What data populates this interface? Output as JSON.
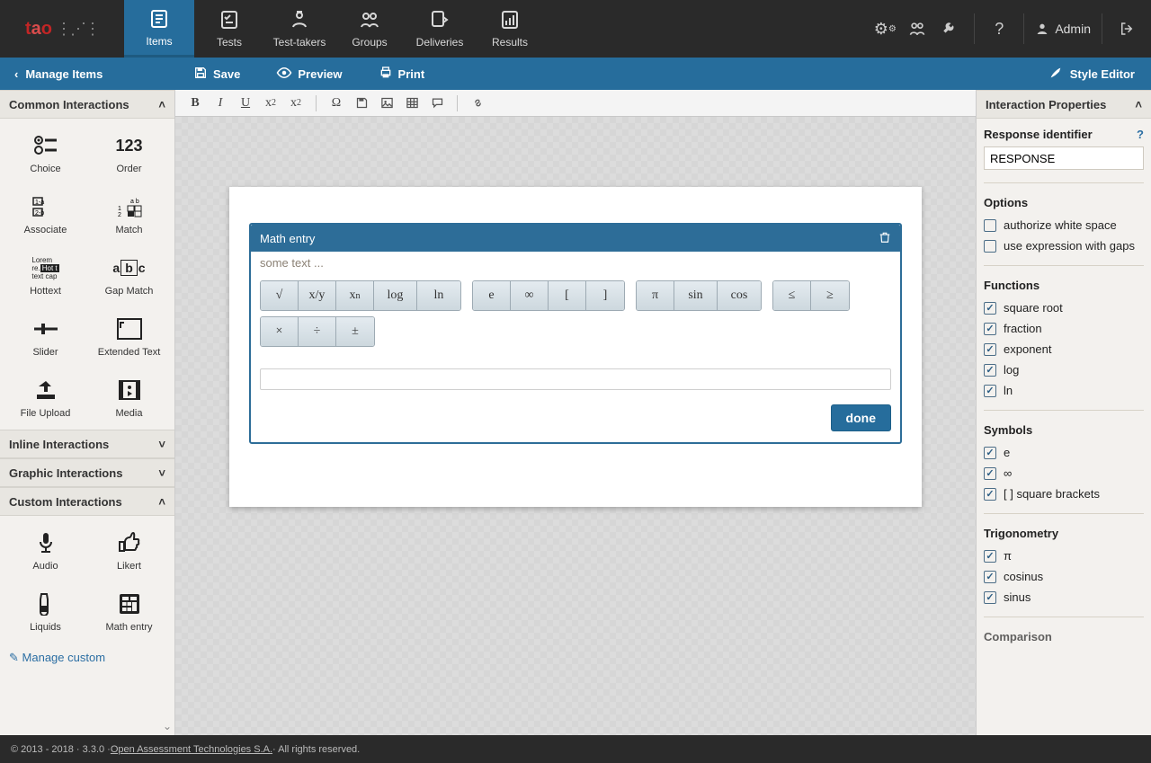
{
  "topnav": {
    "items": [
      {
        "label": "Items"
      },
      {
        "label": "Tests"
      },
      {
        "label": "Test-takers"
      },
      {
        "label": "Groups"
      },
      {
        "label": "Deliveries"
      },
      {
        "label": "Results"
      }
    ],
    "admin": "Admin"
  },
  "subbar": {
    "manage": "Manage Items",
    "save": "Save",
    "preview": "Preview",
    "print": "Print",
    "style_editor": "Style Editor"
  },
  "left": {
    "panels": {
      "common": "Common Interactions",
      "inline": "Inline Interactions",
      "graphic": "Graphic Interactions",
      "custom": "Custom Interactions"
    },
    "common_items": [
      "Choice",
      "Order",
      "Associate",
      "Match",
      "Hottext",
      "Gap Match",
      "Slider",
      "Extended Text",
      "File Upload",
      "Media"
    ],
    "custom_items": [
      "Audio",
      "Likert",
      "Liquids",
      "Math entry"
    ],
    "manage_custom": "Manage custom"
  },
  "widget": {
    "title": "Math entry",
    "placeholder": "some text ...",
    "rows": [
      [
        [
          "√",
          "x/y",
          "xⁿ",
          "log",
          "ln"
        ],
        [
          "e",
          "∞",
          "[",
          "]"
        ],
        [
          "π",
          "sin",
          "cos"
        ],
        [
          "≤",
          "≥"
        ]
      ],
      [
        [
          "×",
          "÷",
          "±"
        ]
      ]
    ],
    "done": "done"
  },
  "right": {
    "interaction_props": "Interaction Properties",
    "response_identifier_label": "Response identifier",
    "response_identifier_value": "RESPONSE",
    "options_label": "Options",
    "options": [
      {
        "label": "authorize white space",
        "checked": false
      },
      {
        "label": "use expression with gaps",
        "checked": false
      }
    ],
    "functions_label": "Functions",
    "functions": [
      {
        "label": "square root",
        "checked": true
      },
      {
        "label": "fraction",
        "checked": true
      },
      {
        "label": "exponent",
        "checked": true
      },
      {
        "label": "log",
        "checked": true
      },
      {
        "label": "ln",
        "checked": true
      }
    ],
    "symbols_label": "Symbols",
    "symbols": [
      {
        "label": "e",
        "checked": true
      },
      {
        "label": "∞",
        "checked": true
      },
      {
        "label": "[ ] square brackets",
        "checked": true
      }
    ],
    "trig_label": "Trigonometry",
    "trig": [
      {
        "label": "π",
        "checked": true
      },
      {
        "label": "cosinus",
        "checked": true
      },
      {
        "label": "sinus",
        "checked": true
      }
    ],
    "comparison_label": "Comparison"
  },
  "footer": {
    "left": "© 2013 - 2018 · 3.3.0 · ",
    "link": "Open Assessment Technologies S.A.",
    "right": " · All rights reserved."
  }
}
